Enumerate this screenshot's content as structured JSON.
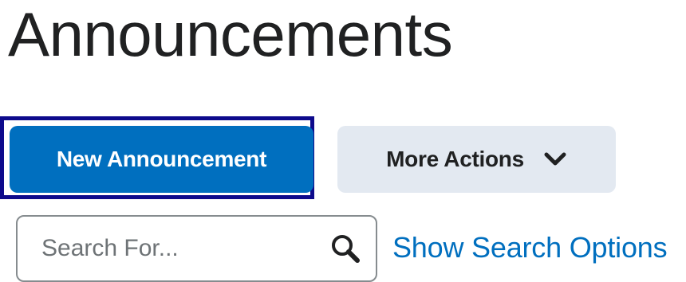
{
  "page": {
    "title": "Announcements"
  },
  "toolbar": {
    "new_announcement_label": "New Announcement",
    "more_actions_label": "More Actions",
    "more_actions_icon": "chevron-down-icon"
  },
  "search": {
    "placeholder": "Search For...",
    "value": "",
    "search_icon": "search-icon",
    "show_options_label": "Show Search Options"
  },
  "colors": {
    "primary": "#006fbf",
    "focus_ring": "#0d0a8c",
    "secondary_bg": "#e3e9f1",
    "text": "#202122",
    "border": "#868c8f"
  }
}
